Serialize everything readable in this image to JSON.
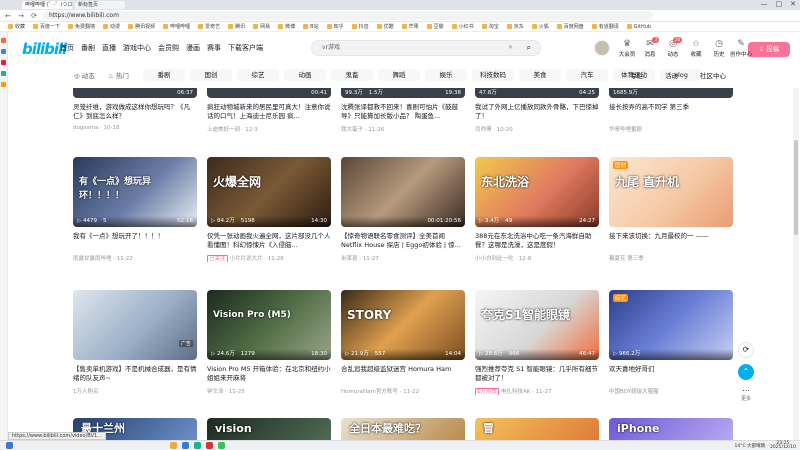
{
  "browser": {
    "tabs": [
      {
        "title": "哔哩哔哩 (゜-゜)つロ 干杯~-bilibili",
        "active": true
      },
      {
        "title": "新标签页",
        "active": false
      }
    ],
    "url": "https://www.bilibili.com",
    "window_controls": [
      "—",
      "□",
      "✕"
    ],
    "bookmarks": [
      "收藏",
      "百度一下",
      "免费翻墙",
      "动漫",
      "腾讯视频",
      "哔哩哔哩",
      "爱奇艺",
      "腾讯",
      "网易",
      "微博",
      "B站",
      "知乎",
      "抖音",
      "优酷",
      "芒果",
      "豆瓣",
      "小红书",
      "淘宝",
      "京东",
      "火狐",
      "百度网盘",
      "有道翻译",
      "GitHub"
    ]
  },
  "header": {
    "logo": "bilibili",
    "nav": [
      "首页",
      "番剧",
      "直播",
      "游戏中心",
      "会员购",
      "漫画",
      "赛事",
      "下载客户端"
    ],
    "search_placeholder": "vr游戏",
    "search_clear": "✕",
    "search_icon": "⌕",
    "right_icons": [
      {
        "label": "大会员",
        "glyph": "♛",
        "badge": ""
      },
      {
        "label": "消息",
        "glyph": "✉",
        "badge": "3"
      },
      {
        "label": "动态",
        "glyph": "◎",
        "badge": "26"
      },
      {
        "label": "收藏",
        "glyph": "☆",
        "badge": ""
      },
      {
        "label": "历史",
        "glyph": "◷",
        "badge": ""
      },
      {
        "label": "创作中心",
        "glyph": "✎",
        "badge": ""
      }
    ],
    "upload": "投稿"
  },
  "channels": {
    "fixed": [
      {
        "label": "动态",
        "glyph": "◎"
      },
      {
        "label": "热门",
        "glyph": "♨"
      }
    ],
    "chips": [
      "番剧",
      "国创",
      "综艺",
      "动画",
      "鬼畜",
      "舞蹈",
      "娱乐",
      "科技数码",
      "美食",
      "汽车",
      "体育运动",
      "vlog"
    ],
    "plain": [
      "专栏",
      "活动",
      "社区中心"
    ]
  },
  "top_partial_row": [
    {
      "title": "灵笼纤维，游戏做成这样你想玩吗？《凡仁》到底怎么样？",
      "owner": "dogsama",
      "date": "10-18",
      "views": "",
      "comments": "",
      "duration": "06:37"
    },
    {
      "title": "疯狂动物城新来的居民里可真大！注意你说话的口气！上海迪士尼乐园 疯...",
      "owner": "上迪美好一刻",
      "date": "12-3",
      "views": "",
      "comments": "",
      "duration": "00:41"
    },
    {
      "title": "沈腾张译都救不回来！喜剧可怕片《鼓鼓导》只能算加长版小品？ 陶蛋鱼...",
      "owner": "我大蛋子",
      "date": "11-26",
      "views": "99.3万",
      "comments": "1.5万",
      "duration": "19:38"
    },
    {
      "title": "我试了外网上亿播放同款外骨骼，下巴惊掉了！",
      "owner": "司师傅",
      "date": "10-20",
      "views": "47.8万",
      "comments": "",
      "duration": "04:25"
    },
    {
      "title": "接长按弄的高不同学 第三季",
      "owner": "华哥哔哩番剧",
      "date": "",
      "views": "1685.9万",
      "comments": "",
      "duration": ""
    }
  ],
  "cards": [
    {
      "title": "我有《一点》想玩开了！！！！",
      "owner": "雨露甘露雨哔哩",
      "date": "11-22",
      "views": "4479",
      "comments": "5",
      "duration": "02:16",
      "tag": "",
      "ad": false,
      "corner": "",
      "overlay": "有《一点》想玩异环！！！！",
      "bg": "linear-gradient(135deg,#2a3a5c,#6d7fa8 55%,#e9eef6)"
    },
    {
      "title": "仅凭一张动画我火遍全网，这片部没几个人看懂图！科幻惊悚片《入侵脑...",
      "owner": "小片片说大片",
      "date": "11-26",
      "views": "84.2万",
      "comments": "5198",
      "duration": "14:30",
      "tag": "已关注",
      "ad": false,
      "corner": "",
      "overlay": "火爆全网",
      "bg": "linear-gradient(135deg,#3b2a1d,#7a5a35 50%,#2c1d12)"
    },
    {
      "title": "【惊奇物语联名零食测评】全美首闻 Netflix House 探店 | Eggo初体验 | 惊...",
      "owner": "米莱喜",
      "date": "11-27",
      "views": "",
      "comments": "",
      "duration": "00:01:20:56",
      "tag": "",
      "ad": false,
      "corner": "",
      "overlay": "",
      "bg": "linear-gradient(135deg,#5a4636,#b69a7e 50%,#3a2c22)"
    },
    {
      "title": "388元在东北洗浴中心吃一条汽海鲜自助餐？这哪是洗澡，这是度假！",
      "owner": "小小白到此一吃",
      "date": "12-8",
      "views": "3.4万",
      "comments": "49",
      "duration": "24:27",
      "tag": "",
      "ad": false,
      "corner": "",
      "overlay": "东北洗浴",
      "bg": "linear-gradient(135deg,#f2c94c,#e07a5f 55%,#8a3b2a)"
    },
    {
      "title": "接下来该切换：九月最校的一 ——",
      "owner": "暮夏花 第三季",
      "date": "",
      "views": "",
      "comments": "",
      "duration": "",
      "tag": "",
      "ad": false,
      "corner": "国创",
      "overlay": "九尾 直升机",
      "bg": "linear-gradient(135deg,#fbe7d0,#f6c9a6 55%,#e99c73)"
    },
    {
      "title": "【售卖单机游戏】不是机械合成器，是有情绪的队友声~",
      "owner": "1万人购买",
      "date": "",
      "views": "",
      "comments": "",
      "duration": "",
      "tag": "",
      "ad": true,
      "corner": "",
      "overlay": "",
      "bg": "linear-gradient(135deg,#dfe6ef,#9cb0c8 55%,#5d6f86)"
    },
    {
      "title": "Vision Pro M5 开箱体验：在北京和纽约小姐姐来开麻将",
      "owner": "钟文泽",
      "date": "11-25",
      "views": "24.6万",
      "comments": "1279",
      "duration": "18:30",
      "tag": "",
      "ad": false,
      "corner": "",
      "overlay": "Vision Pro (M5)",
      "bg": "linear-gradient(135deg,#1c2a1f,#4f6b44 50%,#9aa68a)"
    },
    {
      "title": "合乱追我超级监狱迷宫 Homura Ham",
      "owner": "HomuraHam官方账号",
      "date": "11-22",
      "views": "21.9万",
      "comments": "557",
      "duration": "14:04",
      "tag": "",
      "ad": false,
      "corner": "",
      "overlay": "STORY",
      "bg": "linear-gradient(135deg,#3a2a18,#e0a050 50%,#7a4f22)"
    },
    {
      "title": "强烈推荐夸克 S1 智能眼镜：几乎所有细节都被对了！",
      "owner": "电扎科技AK",
      "date": "11-27",
      "views": "29.8万",
      "comments": "966",
      "duration": "46:47",
      "tag": "1万点赞",
      "ad": false,
      "corner": "",
      "overlay": "夸克S1智能眼镜",
      "bg": "linear-gradient(135deg,#f5f5f5,#d7d7d7 55%,#f06d3b)"
    },
    {
      "title": "欢天喜地好哥们",
      "owner": "中国BOY超级大猩猩",
      "date": "",
      "views": "966.2万",
      "comments": "",
      "duration": "",
      "tag": "",
      "ad": false,
      "corner": "综艺",
      "overlay": "",
      "bg": "linear-gradient(135deg,#2d3e8c,#6a7fd6 50%,#c7d0f5)"
    }
  ],
  "bottom_partial_row": [
    {
      "overlay": "最十兰州",
      "bg": "linear-gradient(135deg,#25406b,#6b8fc7)"
    },
    {
      "overlay": "vision",
      "bg": "linear-gradient(135deg,#1d2a22,#4f6b55)"
    },
    {
      "overlay": "全日本最难吃？",
      "bg": "linear-gradient(135deg,#e9e2cf,#b98a4c)"
    },
    {
      "overlay": "冒",
      "bg": "linear-gradient(135deg,#f3c25a,#e07b39)"
    },
    {
      "overlay": "iPhone",
      "bg": "linear-gradient(135deg,#6d5ad6,#b7a8f2)"
    }
  ],
  "floating": {
    "refresh": "⟳",
    "up": "⌃",
    "more": "⋯",
    "more_label": "更多"
  },
  "status_url": "https://www.bilibili.com/video/BV1...",
  "taskbar": {
    "weather": "14°C 大部晴朗",
    "time": "23:25",
    "date": "2025/12/10"
  },
  "colors": {
    "accent": "#00aeec",
    "pink": "#fb7299",
    "badge": "#fa5a57"
  }
}
